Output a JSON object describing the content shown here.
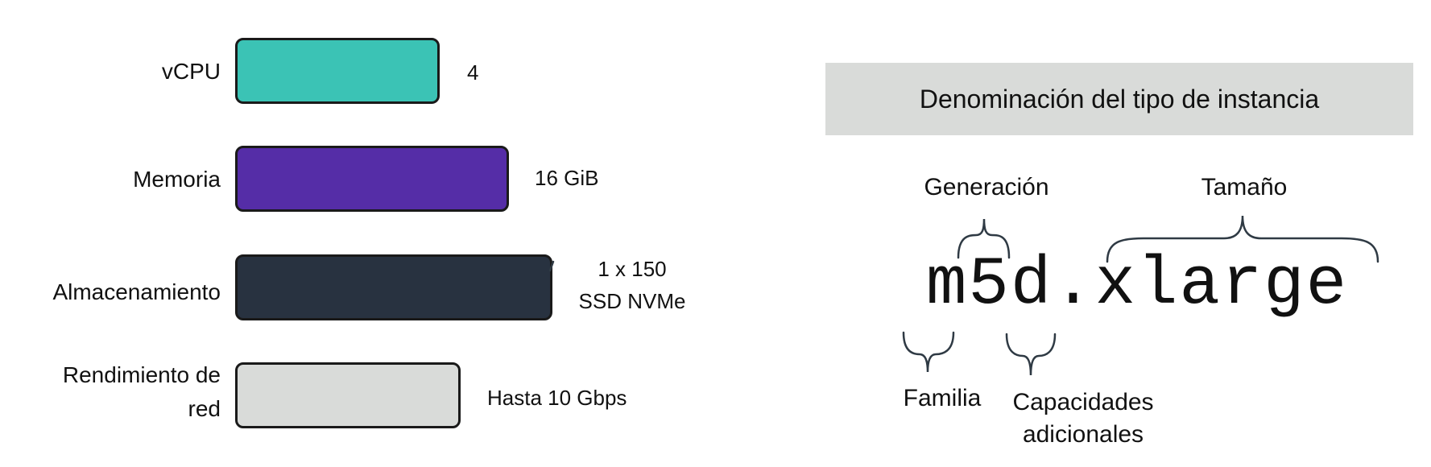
{
  "specs": [
    {
      "label": "vCPU",
      "value": "4",
      "bar_color": "#3bc3b5",
      "relative_size": 0.64
    },
    {
      "label": "Memoria",
      "value": "16 GiB",
      "bar_color": "#552da7",
      "relative_size": 0.86
    },
    {
      "label": "Almacenamiento",
      "value_line1": "1 x 150",
      "value_line2": "SSD NVMe",
      "bar_color": "#283240",
      "relative_size": 1.0
    },
    {
      "label_line1": "Rendimiento de",
      "label_line2": "red",
      "value": "Hasta 10 Gbps",
      "bar_color": "#d9dbd9",
      "relative_size": 0.7
    }
  ],
  "naming": {
    "title": "Denominación del tipo de instancia",
    "instance_type": "m5d.xlarge",
    "parts": {
      "generation": "Generación",
      "size": "Tamaño",
      "family": "Familia",
      "additional_capabilities_line1": "Capacidades",
      "additional_capabilities_line2": "adicionales"
    }
  }
}
